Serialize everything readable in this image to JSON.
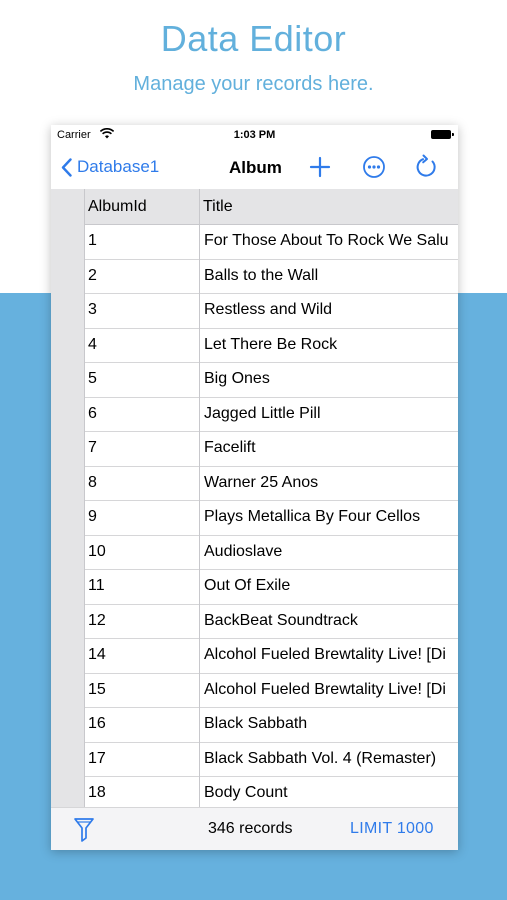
{
  "promo": {
    "title": "Data Editor",
    "subtitle": "Manage your records here."
  },
  "status_bar": {
    "carrier": "Carrier",
    "time": "1:03 PM"
  },
  "nav": {
    "back_label": "Database1",
    "title": "Album",
    "icons": [
      "chevron-left-icon",
      "plus-icon",
      "more-icon",
      "refresh-icon"
    ]
  },
  "table": {
    "columns": [
      "AlbumId",
      "Title"
    ],
    "rows": [
      {
        "id": "1",
        "title": "For Those About To Rock We Salu"
      },
      {
        "id": "2",
        "title": "Balls to the Wall"
      },
      {
        "id": "3",
        "title": "Restless and Wild"
      },
      {
        "id": "4",
        "title": "Let There Be Rock"
      },
      {
        "id": "5",
        "title": "Big Ones"
      },
      {
        "id": "6",
        "title": "Jagged Little Pill"
      },
      {
        "id": "7",
        "title": "Facelift"
      },
      {
        "id": "8",
        "title": "Warner 25 Anos"
      },
      {
        "id": "9",
        "title": "Plays Metallica By Four Cellos"
      },
      {
        "id": "10",
        "title": "Audioslave"
      },
      {
        "id": "11",
        "title": "Out Of Exile"
      },
      {
        "id": "12",
        "title": "BackBeat Soundtrack"
      },
      {
        "id": "14",
        "title": "Alcohol Fueled Brewtality Live! [Di"
      },
      {
        "id": "15",
        "title": "Alcohol Fueled Brewtality Live! [Di"
      },
      {
        "id": "16",
        "title": "Black Sabbath"
      },
      {
        "id": "17",
        "title": "Black Sabbath Vol. 4 (Remaster)"
      },
      {
        "id": "18",
        "title": "Body Count"
      }
    ]
  },
  "toolbar": {
    "record_count": "346 records",
    "limit_label": "LIMIT 1000",
    "filter_icon": "filter-icon"
  },
  "colors": {
    "accent": "#2f7bea",
    "promo_text": "#62b0dc",
    "band": "#66b1de"
  }
}
